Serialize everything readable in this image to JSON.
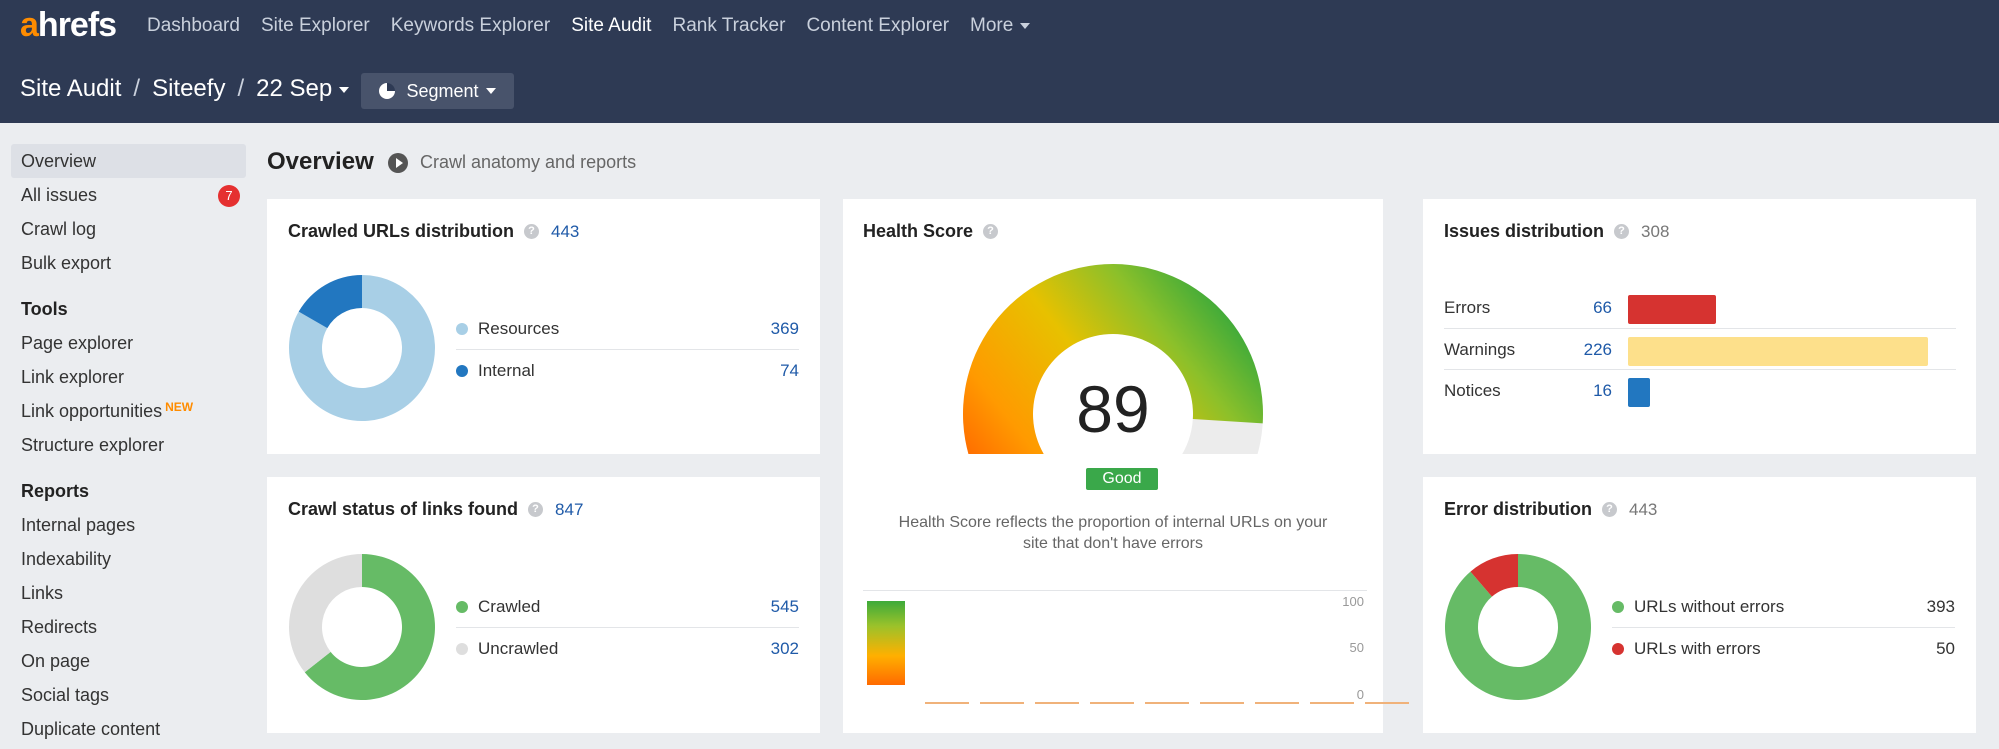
{
  "logo": "ahrefs",
  "nav": [
    "Dashboard",
    "Site Explorer",
    "Keywords Explorer",
    "Site Audit",
    "Rank Tracker",
    "Content Explorer",
    "More"
  ],
  "breadcrumb": {
    "part1": "Site Audit",
    "part2": "Siteefy",
    "part3": "22 Sep",
    "sep": "/"
  },
  "segment_label": "Segment",
  "sidebar": {
    "items": [
      "Overview",
      "All issues",
      "Crawl log",
      "Bulk export"
    ],
    "issues_badge": "7",
    "tools_heading": "Tools",
    "tools": [
      "Page explorer",
      "Link explorer",
      "Link opportunities",
      "Structure explorer"
    ],
    "new_tag": "NEW",
    "reports_heading": "Reports",
    "reports": [
      "Internal pages",
      "Indexability",
      "Links",
      "Redirects",
      "On page",
      "Social tags",
      "Duplicate content"
    ]
  },
  "page": {
    "title": "Overview",
    "anatomy_link": "Crawl anatomy and reports"
  },
  "crawled_urls": {
    "title": "Crawled URLs distribution",
    "total": "443",
    "rows": [
      {
        "label": "Resources",
        "value": "369",
        "color": "#a8cfe6",
        "n": 369
      },
      {
        "label": "Internal",
        "value": "74",
        "color": "#2277c0",
        "n": 74
      }
    ]
  },
  "crawl_status": {
    "title": "Crawl status of links found",
    "total": "847",
    "rows": [
      {
        "label": "Crawled",
        "value": "545",
        "color": "#66bb66",
        "n": 545
      },
      {
        "label": "Uncrawled",
        "value": "302",
        "color": "#dedede",
        "n": 302
      }
    ]
  },
  "health": {
    "title": "Health Score",
    "score": "89",
    "score_value": 89,
    "status": "Good",
    "description_line1": "Health Score reflects the proportion of internal URLs on your",
    "description_line2": "site that don't have errors",
    "axis_ticks": [
      "100",
      "50",
      "0"
    ]
  },
  "issues": {
    "title": "Issues distribution",
    "total": "308",
    "rows": [
      {
        "label": "Errors",
        "value": "66",
        "color": "#d63330",
        "n": 66
      },
      {
        "label": "Warnings",
        "value": "226",
        "color": "#fde08b",
        "n": 226
      },
      {
        "label": "Notices",
        "value": "16",
        "color": "#2277c0",
        "n": 16
      }
    ]
  },
  "errors": {
    "title": "Error distribution",
    "total": "443",
    "rows": [
      {
        "label": "URLs without errors",
        "value": "393",
        "color": "#66bb66",
        "n": 393
      },
      {
        "label": "URLs with errors",
        "value": "50",
        "color": "#d63330",
        "n": 50
      }
    ]
  }
}
